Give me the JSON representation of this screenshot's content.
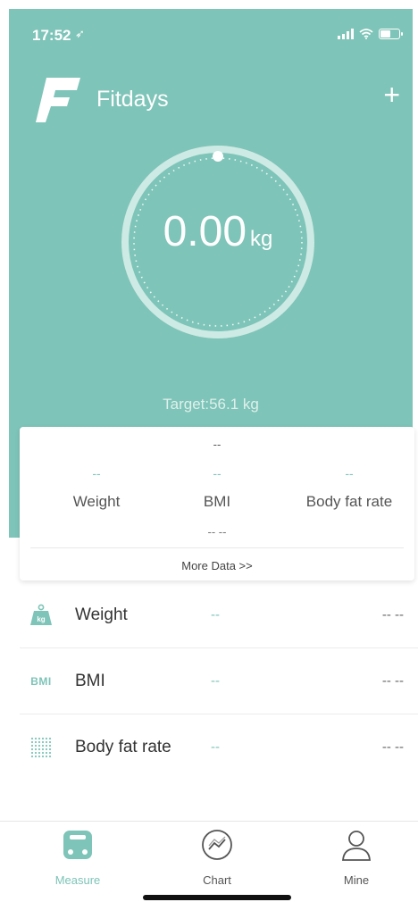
{
  "status_bar": {
    "time": "17:52",
    "arrow": "➶"
  },
  "header": {
    "app_name": "Fitdays",
    "add_icon": "+"
  },
  "scale": {
    "value": "0.00",
    "unit": "kg",
    "target": "Target:56.1 kg"
  },
  "summary": {
    "top_value": "--",
    "columns": [
      {
        "value": "--",
        "label": "Weight"
      },
      {
        "value": "--",
        "label": "BMI"
      },
      {
        "value": "--",
        "label": "Body fat rate"
      }
    ],
    "date": "-- --",
    "more_data": "More Data >>"
  },
  "metrics": [
    {
      "icon": "weight-icon",
      "label": "Weight",
      "value": "--",
      "date": "-- --"
    },
    {
      "icon": "bmi-icon",
      "icon_text": "BMI",
      "label": "BMI",
      "value": "--",
      "date": "-- --"
    },
    {
      "icon": "body-fat-icon",
      "label": "Body fat rate",
      "value": "--",
      "date": "-- --"
    }
  ],
  "tabs": [
    {
      "label": "Measure",
      "icon": "scale-icon",
      "active": true
    },
    {
      "label": "Chart",
      "icon": "chart-icon",
      "active": false
    },
    {
      "label": "Mine",
      "icon": "user-icon",
      "active": false
    }
  ],
  "colors": {
    "accent": "#7ec4b8",
    "tab_active": "#7ec4b8",
    "tab_inactive": "#555555"
  }
}
